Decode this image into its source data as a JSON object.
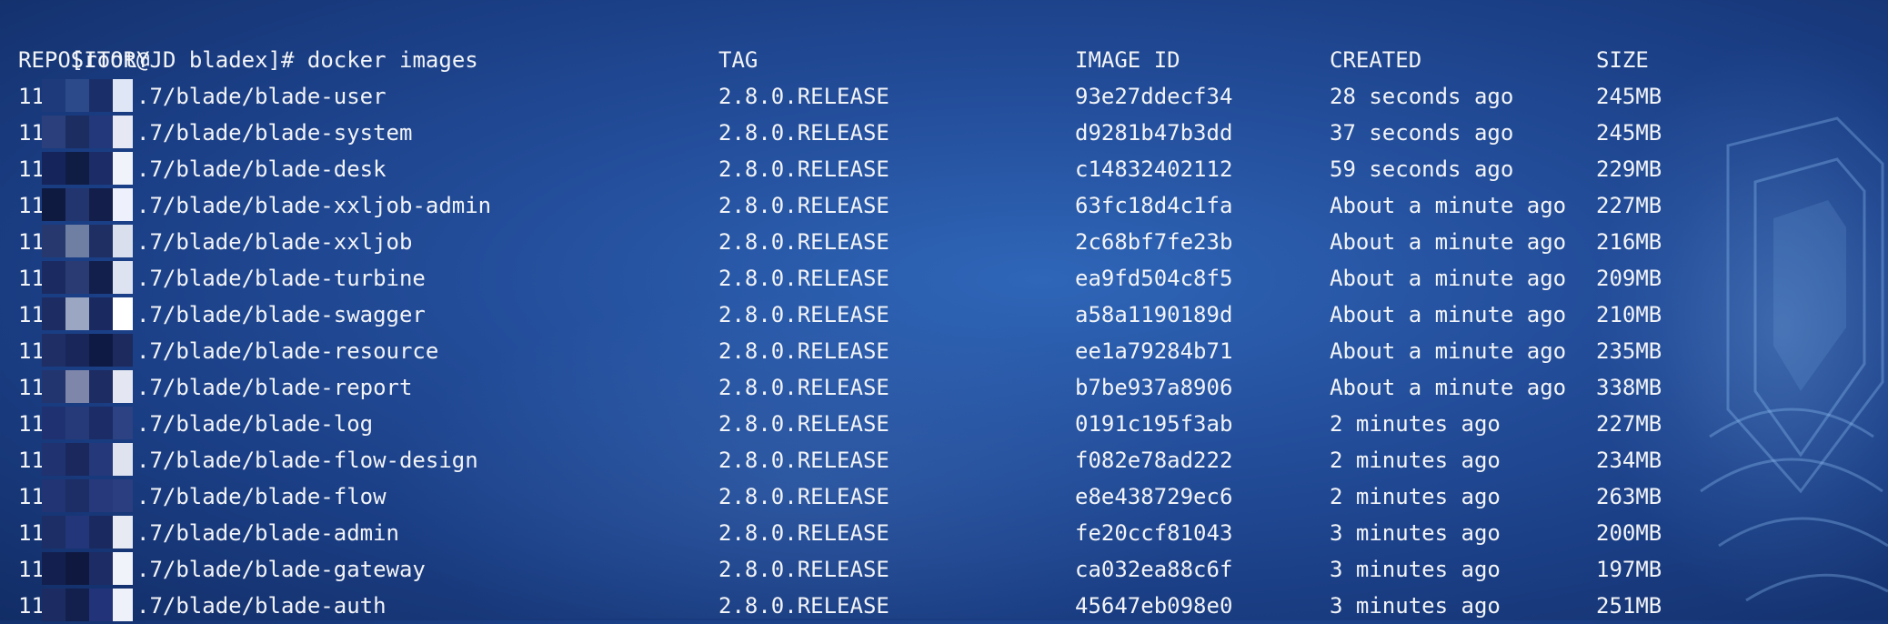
{
  "terminal": {
    "prompt": "[root@JD bladex]# docker images",
    "headers": {
      "repository": "REPOSITORY",
      "tag": "TAG",
      "image_id": "IMAGE ID",
      "created": "CREATED",
      "size": "SIZE"
    },
    "rows": [
      {
        "repo_prefix": "11",
        "repo_suffix": ".7/blade/blade-user",
        "tag": "2.8.0.RELEASE",
        "image_id": "93e27ddecf34",
        "created": "28 seconds ago",
        "size": "245MB"
      },
      {
        "repo_prefix": "11",
        "repo_suffix": ".7/blade/blade-system",
        "tag": "2.8.0.RELEASE",
        "image_id": "d9281b47b3dd",
        "created": "37 seconds ago",
        "size": "245MB"
      },
      {
        "repo_prefix": "11",
        "repo_suffix": ".7/blade/blade-desk",
        "tag": "2.8.0.RELEASE",
        "image_id": "c14832402112",
        "created": "59 seconds ago",
        "size": "229MB"
      },
      {
        "repo_prefix": "11",
        "repo_suffix": ".7/blade/blade-xxljob-admin",
        "tag": "2.8.0.RELEASE",
        "image_id": "63fc18d4c1fa",
        "created": "About a minute ago",
        "size": "227MB"
      },
      {
        "repo_prefix": "11",
        "repo_suffix": ".7/blade/blade-xxljob",
        "tag": "2.8.0.RELEASE",
        "image_id": "2c68bf7fe23b",
        "created": "About a minute ago",
        "size": "216MB"
      },
      {
        "repo_prefix": "11",
        "repo_suffix": ".7/blade/blade-turbine",
        "tag": "2.8.0.RELEASE",
        "image_id": "ea9fd504c8f5",
        "created": "About a minute ago",
        "size": "209MB"
      },
      {
        "repo_prefix": "11",
        "repo_suffix": ".7/blade/blade-swagger",
        "tag": "2.8.0.RELEASE",
        "image_id": "a58a1190189d",
        "created": "About a minute ago",
        "size": "210MB"
      },
      {
        "repo_prefix": "11",
        "repo_suffix": ".7/blade/blade-resource",
        "tag": "2.8.0.RELEASE",
        "image_id": "ee1a79284b71",
        "created": "About a minute ago",
        "size": "235MB"
      },
      {
        "repo_prefix": "11",
        "repo_suffix": ".7/blade/blade-report",
        "tag": "2.8.0.RELEASE",
        "image_id": "b7be937a8906",
        "created": "About a minute ago",
        "size": "338MB"
      },
      {
        "repo_prefix": "11",
        "repo_suffix": ".7/blade/blade-log",
        "tag": "2.8.0.RELEASE",
        "image_id": "0191c195f3ab",
        "created": "2 minutes ago",
        "size": "227MB"
      },
      {
        "repo_prefix": "11",
        "repo_suffix": ".7/blade/blade-flow-design",
        "tag": "2.8.0.RELEASE",
        "image_id": "f082e78ad222",
        "created": "2 minutes ago",
        "size": "234MB"
      },
      {
        "repo_prefix": "11",
        "repo_suffix": ".7/blade/blade-flow",
        "tag": "2.8.0.RELEASE",
        "image_id": "e8e438729ec6",
        "created": "2 minutes ago",
        "size": "263MB"
      },
      {
        "repo_prefix": "11",
        "repo_suffix": ".7/blade/blade-admin",
        "tag": "2.8.0.RELEASE",
        "image_id": "fe20ccf81043",
        "created": "3 minutes ago",
        "size": "200MB"
      },
      {
        "repo_prefix": "11",
        "repo_suffix": ".7/blade/blade-gateway",
        "tag": "2.8.0.RELEASE",
        "image_id": "ca032ea88c6f",
        "created": "3 minutes ago",
        "size": "197MB"
      },
      {
        "repo_prefix": "11",
        "repo_suffix": ".7/blade/blade-auth",
        "tag": "2.8.0.RELEASE",
        "image_id": "45647eb098e0",
        "created": "3 minutes ago",
        "size": "251MB"
      }
    ]
  },
  "colors": {
    "text": "#f2f4f8",
    "background": "#244f9c"
  },
  "icons": {
    "background": "wallpaper-emblem-icon",
    "redaction": "pixelated-redaction-mosaic"
  }
}
